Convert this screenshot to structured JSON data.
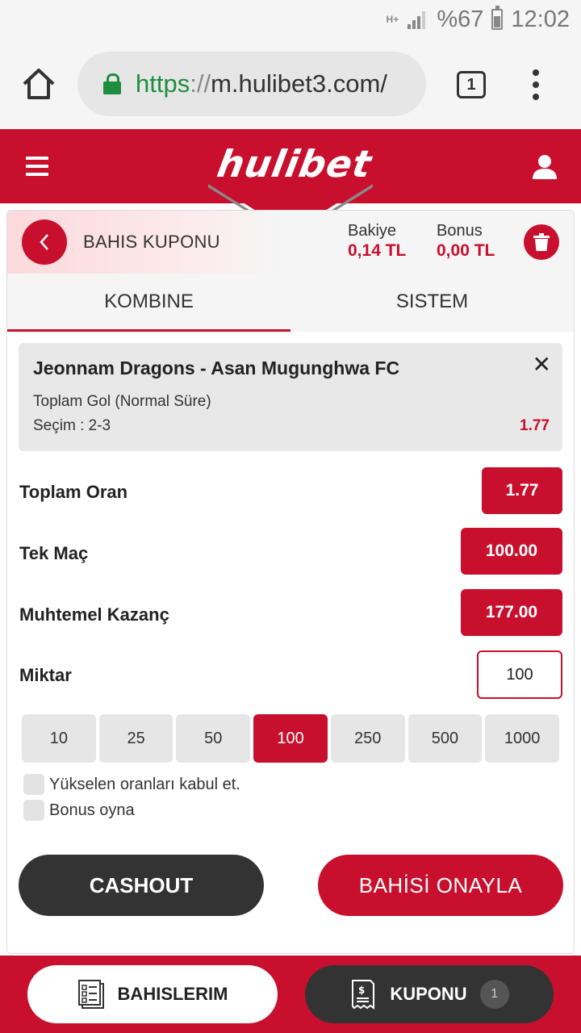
{
  "status_bar": {
    "network": "H+",
    "battery": "%67",
    "time": "12:02"
  },
  "browser": {
    "url_scheme": "https",
    "url_sep": "://",
    "url_host": "m.hulibet3.com/",
    "tab_count": "1"
  },
  "header": {
    "logo": "hulibet"
  },
  "coupon": {
    "title": "BAHIS KUPONU",
    "balance_label": "Bakiye",
    "balance_value": "0,14 TL",
    "bonus_label": "Bonus",
    "bonus_value": "0,00 TL"
  },
  "tabs": [
    {
      "label": "KOMBINE",
      "active": true
    },
    {
      "label": "SISTEM",
      "active": false
    }
  ],
  "selection": {
    "match": "Jeonnam Dragons - Asan Mugunghwa FC",
    "market": "Toplam Gol (Normal Süre)",
    "pick": "Seçim : 2-3",
    "odd": "1.77",
    "close": "✕"
  },
  "summary": {
    "total_odds_label": "Toplam Oran",
    "total_odds_value": "1.77",
    "single_label": "Tek Maç",
    "single_value": "100.00",
    "potential_label": "Muhtemel Kazanç",
    "potential_value": "177.00",
    "amount_label": "Miktar",
    "amount_value": "100"
  },
  "quick_amounts": [
    "10",
    "25",
    "50",
    "100",
    "250",
    "500",
    "1000"
  ],
  "quick_amount_selected": "100",
  "options": {
    "accept_odds": "Yükselen oranları kabul et.",
    "play_bonus": "Bonus oyna"
  },
  "actions": {
    "cashout": "CASHOUT",
    "confirm": "BAHİSİ ONAYLA"
  },
  "bottom_nav": {
    "bets": "BAHISLERIM",
    "coupon": "KUPONU",
    "coupon_badge": "1"
  },
  "colors": {
    "brand_red": "#c8102e",
    "dark": "#333333"
  }
}
